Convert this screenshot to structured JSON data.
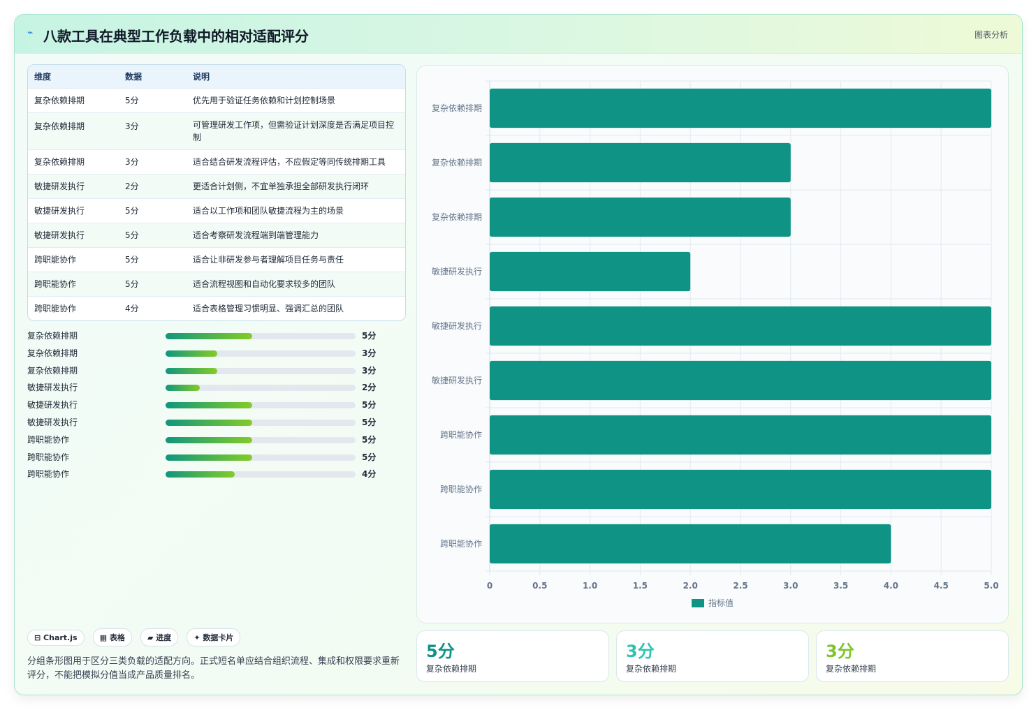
{
  "header": {
    "icon": "chart-line-icon",
    "title": "八款工具在典型工作负载中的相对适配评分",
    "tag": "图表分析"
  },
  "table": {
    "headers": [
      "维度",
      "数据",
      "说明"
    ],
    "rows": [
      [
        "复杂依赖排期",
        "5分",
        "优先用于验证任务依赖和计划控制场景"
      ],
      [
        "复杂依赖排期",
        "3分",
        "可管理研发工作项，但需验证计划深度是否满足项目控制"
      ],
      [
        "复杂依赖排期",
        "3分",
        "适合结合研发流程评估，不应假定等同传统排期工具"
      ],
      [
        "敏捷研发执行",
        "2分",
        "更适合计划侧，不宜单独承担全部研发执行闭环"
      ],
      [
        "敏捷研发执行",
        "5分",
        "适合以工作项和团队敏捷流程为主的场景"
      ],
      [
        "敏捷研发执行",
        "5分",
        "适合考察研发流程端到端管理能力"
      ],
      [
        "跨职能协作",
        "5分",
        "适合让非研发参与者理解项目任务与责任"
      ],
      [
        "跨职能协作",
        "5分",
        "适合流程视图和自动化要求较多的团队"
      ],
      [
        "跨职能协作",
        "4分",
        "适合表格管理习惯明显、强调汇总的团队"
      ]
    ]
  },
  "progress": [
    {
      "label": "复杂依赖排期",
      "value": 5,
      "text": "5分",
      "fraction": 0.4545
    },
    {
      "label": "复杂依赖排期",
      "value": 3,
      "text": "3分",
      "fraction": 0.2727
    },
    {
      "label": "复杂依赖排期",
      "value": 3,
      "text": "3分",
      "fraction": 0.2727
    },
    {
      "label": "敏捷研发执行",
      "value": 2,
      "text": "2分",
      "fraction": 0.1818
    },
    {
      "label": "敏捷研发执行",
      "value": 5,
      "text": "5分",
      "fraction": 0.4545
    },
    {
      "label": "敏捷研发执行",
      "value": 5,
      "text": "5分",
      "fraction": 0.4545
    },
    {
      "label": "跨职能协作",
      "value": 5,
      "text": "5分",
      "fraction": 0.4545
    },
    {
      "label": "跨职能协作",
      "value": 5,
      "text": "5分",
      "fraction": 0.4545
    },
    {
      "label": "跨职能协作",
      "value": 4,
      "text": "4分",
      "fraction": 0.3636
    }
  ],
  "pills": [
    "⊟ Chart.js",
    "▦ 表格",
    "▰ 进度",
    "✦ 数据卡片"
  ],
  "note": "分组条形图用于区分三类负载的适配方向。正式短名单应结合组织流程、集成和权限要求重新评分，不能把模拟分值当成产品质量排名。",
  "kpis": [
    {
      "value": "5分",
      "label": "复杂依赖排期",
      "color": "#0e9384"
    },
    {
      "value": "3分",
      "label": "复杂依赖排期",
      "color": "#2dc4b0"
    },
    {
      "value": "3分",
      "label": "复杂依赖排期",
      "color": "#7cc62a"
    }
  ],
  "chart_data": {
    "type": "bar",
    "orientation": "horizontal",
    "categories": [
      "复杂依赖排期",
      "复杂依赖排期",
      "复杂依赖排期",
      "敏捷研发执行",
      "敏捷研发执行",
      "敏捷研发执行",
      "跨职能协作",
      "跨职能协作",
      "跨职能协作"
    ],
    "series": [
      {
        "name": "指标值",
        "values": [
          5,
          3,
          3,
          2,
          5,
          5,
          5,
          5,
          4
        ],
        "color": "#0e9384"
      }
    ],
    "xlim": [
      0,
      5
    ],
    "xticks": [
      "0",
      "0.5",
      "1.0",
      "1.5",
      "2.0",
      "2.5",
      "3.0",
      "3.5",
      "4.0",
      "4.5",
      "5.0"
    ],
    "grid": true,
    "legend": "bottom"
  }
}
